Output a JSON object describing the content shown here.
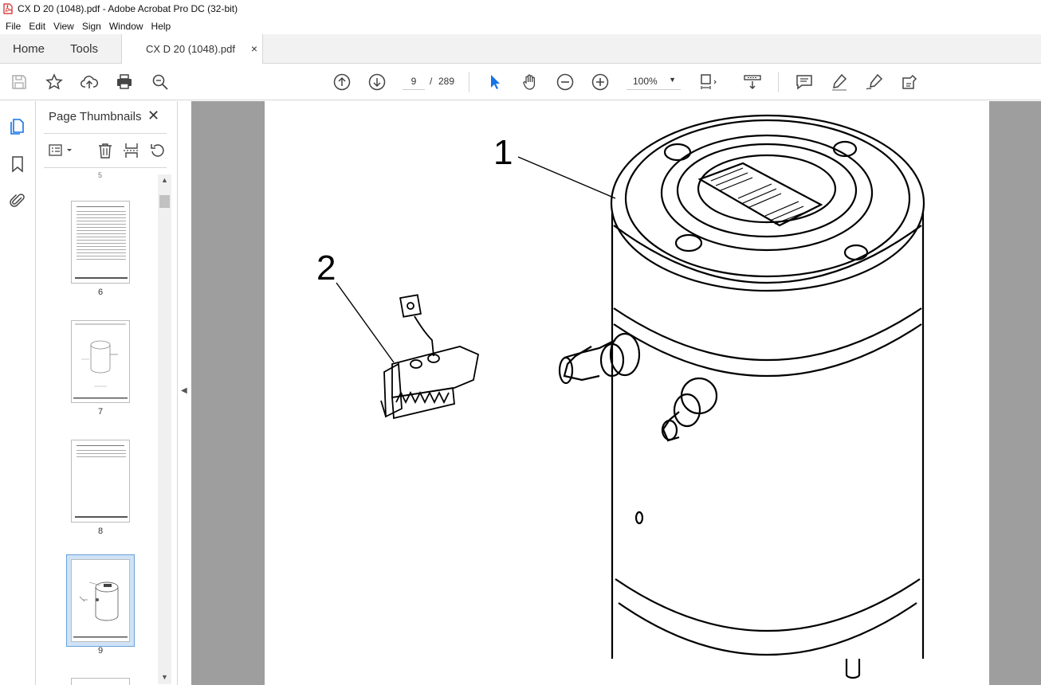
{
  "window": {
    "title": "CX D 20 (1048).pdf - Adobe Acrobat Pro DC (32-bit)"
  },
  "menu": [
    "File",
    "Edit",
    "View",
    "Sign",
    "Window",
    "Help"
  ],
  "tabs": {
    "home": "Home",
    "tools": "Tools",
    "document": "CX D 20 (1048).pdf",
    "close_glyph": "×"
  },
  "toolbar": {
    "current_page": "9",
    "page_separator": "/",
    "total_pages": "289",
    "zoom": "100%"
  },
  "thumbnails_panel": {
    "title": "Page Thumbnails",
    "close_glyph": "✕",
    "pages": [
      {
        "label": "6",
        "kind": "table"
      },
      {
        "label": "7",
        "kind": "drawing"
      },
      {
        "label": "8",
        "kind": "short-table"
      },
      {
        "label": "9",
        "kind": "drawing",
        "selected": true
      }
    ]
  },
  "document": {
    "callouts": [
      "1",
      "2"
    ]
  },
  "colors": {
    "accent": "#1473e6",
    "doc_background": "#9e9e9e",
    "pdf_icon": "#d4221d"
  }
}
